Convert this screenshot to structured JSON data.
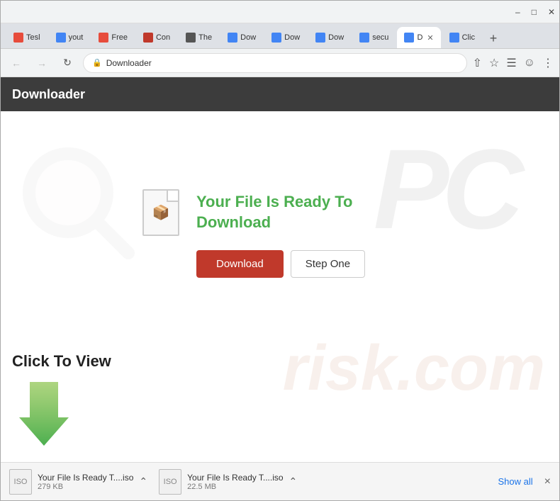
{
  "browser": {
    "tabs": [
      {
        "label": "Tesl",
        "active": false,
        "favicon": "T"
      },
      {
        "label": "yout",
        "active": false,
        "favicon": "G"
      },
      {
        "label": "Free",
        "active": false,
        "favicon": "F"
      },
      {
        "label": "Con",
        "active": false,
        "favicon": "C"
      },
      {
        "label": "The",
        "active": false,
        "favicon": "T"
      },
      {
        "label": "Dow",
        "active": false,
        "favicon": "D"
      },
      {
        "label": "Dow",
        "active": false,
        "favicon": "D"
      },
      {
        "label": "Dow",
        "active": false,
        "favicon": "D"
      },
      {
        "label": "secu",
        "active": false,
        "favicon": "S"
      },
      {
        "label": "D",
        "active": true,
        "favicon": "D"
      },
      {
        "label": "Clic",
        "active": false,
        "favicon": "C"
      }
    ],
    "address": "Downloader",
    "new_tab_label": "+"
  },
  "navbar": {
    "title": "Downloader"
  },
  "page": {
    "ready_text": "Your File Is Ready To\nDownload",
    "download_button": "Download",
    "step_one_button": "Step One",
    "click_to_view": "Click To View"
  },
  "downloads_bar": {
    "items": [
      {
        "name": "Your File Is Ready T....iso",
        "size": "279 KB"
      },
      {
        "name": "Your File Is Ready T....iso",
        "size": "22.5 MB"
      }
    ],
    "show_all": "Show all",
    "close": "×"
  },
  "colors": {
    "download_btn": "#c0392b",
    "ready_text": "#4caf50",
    "navbar_bg": "#3c3c3c"
  }
}
